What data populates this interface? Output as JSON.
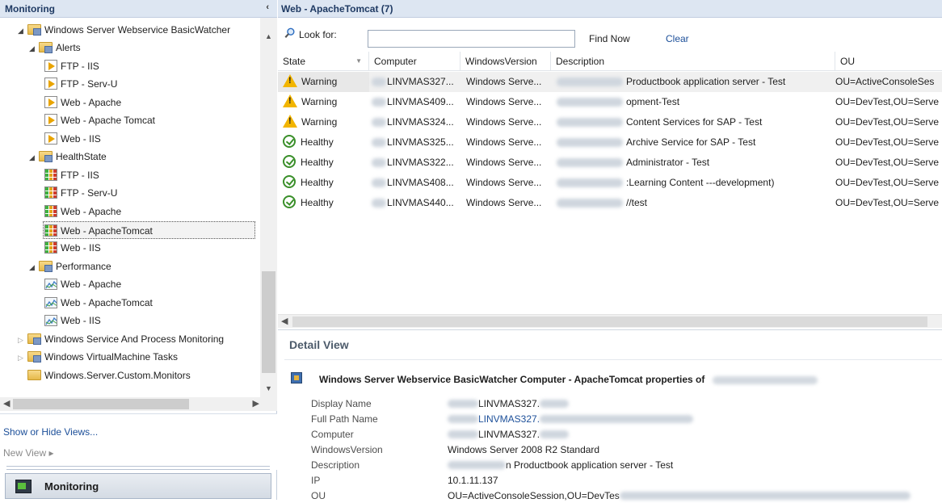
{
  "left_pane": {
    "title": "Monitoring",
    "collapse_glyph": "‹",
    "tree": [
      {
        "label": "Windows Server Webservice BasicWatcher",
        "icon": "folder-icon",
        "expanded": true,
        "level": 0
      },
      {
        "label": "Alerts",
        "icon": "folder-icon",
        "expanded": true,
        "level": 1
      },
      {
        "label": "FTP - IIS",
        "icon": "alert-view-icon",
        "level": 2
      },
      {
        "label": "FTP - Serv-U",
        "icon": "alert-view-icon",
        "level": 2
      },
      {
        "label": "Web - Apache",
        "icon": "alert-view-icon",
        "level": 2
      },
      {
        "label": "Web - Apache Tomcat",
        "icon": "alert-view-icon",
        "level": 2
      },
      {
        "label": "Web - IIS",
        "icon": "alert-view-icon",
        "level": 2
      },
      {
        "label": "HealthState",
        "icon": "folder-icon",
        "expanded": true,
        "level": 1
      },
      {
        "label": "FTP - IIS",
        "icon": "state-view-icon",
        "level": 2
      },
      {
        "label": "FTP - Serv-U",
        "icon": "state-view-icon",
        "level": 2
      },
      {
        "label": "Web - Apache",
        "icon": "state-view-icon",
        "level": 2
      },
      {
        "label": "Web - ApacheTomcat",
        "icon": "state-view-icon",
        "level": 2,
        "selected": true
      },
      {
        "label": "Web - IIS",
        "icon": "state-view-icon",
        "level": 2
      },
      {
        "label": "Performance",
        "icon": "folder-icon",
        "expanded": true,
        "level": 1
      },
      {
        "label": "Web - Apache",
        "icon": "performance-view-icon",
        "level": 2
      },
      {
        "label": "Web - ApacheTomcat",
        "icon": "performance-view-icon",
        "level": 2
      },
      {
        "label": "Web - IIS",
        "icon": "performance-view-icon",
        "level": 2
      },
      {
        "label": "Windows Service And Process Monitoring",
        "icon": "folder-icon",
        "expanded": false,
        "level": 0
      },
      {
        "label": "Windows VirtualMachine Tasks",
        "icon": "folder-icon",
        "expanded": false,
        "level": 0
      },
      {
        "label": "Windows.Server.Custom.Monitors",
        "icon": "folder-icon",
        "level": 0
      }
    ],
    "show_hide_views": "Show or Hide Views...",
    "new_view": "New View ▸",
    "wunderbar_label": "Monitoring"
  },
  "right_pane": {
    "view_title": "Web - ApacheTomcat (7)",
    "search": {
      "label": "Look for:",
      "value": "",
      "find_now": "Find Now",
      "clear": "Clear"
    },
    "columns": [
      "State",
      "Computer",
      "WindowsVersion",
      "Description",
      "OU"
    ],
    "rows": [
      {
        "state": "Warning",
        "computer": "LINVMAS327...",
        "version": "Windows Serve...",
        "description": "Productbook application server - Test",
        "ou": "OU=ActiveConsoleSes"
      },
      {
        "state": "Warning",
        "computer": "LINVMAS409...",
        "version": "Windows Serve...",
        "description": "opment-Test",
        "ou": "OU=DevTest,OU=Serve"
      },
      {
        "state": "Warning",
        "computer": "LINVMAS324...",
        "version": "Windows Serve...",
        "description": "Content Services for SAP - Test",
        "ou": "OU=DevTest,OU=Serve"
      },
      {
        "state": "Healthy",
        "computer": "LINVMAS325...",
        "version": "Windows Serve...",
        "description": "Archive Service for SAP - Test",
        "ou": "OU=DevTest,OU=Serve"
      },
      {
        "state": "Healthy",
        "computer": "LINVMAS322...",
        "version": "Windows Serve...",
        "description": "Administrator - Test",
        "ou": "OU=DevTest,OU=Serve"
      },
      {
        "state": "Healthy",
        "computer": "LINVMAS408...",
        "version": "Windows Serve...",
        "description": ":Learning Content ---development)",
        "ou": "OU=DevTest,OU=Serve"
      },
      {
        "state": "Healthy",
        "computer": "LINVMAS440...",
        "version": "Windows Serve...",
        "description": "//test",
        "ou": "OU=DevTest,OU=Serve"
      }
    ],
    "detail": {
      "title": "Detail View",
      "properties_title": "Windows Server Webservice BasicWatcher Computer - ApacheTomcat properties of",
      "properties": [
        {
          "label": "Display Name",
          "value": "LINVMAS327."
        },
        {
          "label": "Full Path Name",
          "value": "LINVMAS327."
        },
        {
          "label": "Computer",
          "value": "LINVMAS327."
        },
        {
          "label": "WindowsVersion",
          "value": "Windows Server 2008 R2 Standard"
        },
        {
          "label": "Description",
          "value": "n Productbook application server - Test"
        },
        {
          "label": "IP",
          "value": "10.1.11.137"
        },
        {
          "label": "OU",
          "value": "OU=ActiveConsoleSession,OU=DevTes"
        }
      ]
    }
  },
  "colors": {
    "header_bg": "#dde6f2",
    "header_text": "#1f3a63",
    "link": "#1c4f99",
    "warning": "#f2b500",
    "healthy": "#3a8f2a"
  }
}
